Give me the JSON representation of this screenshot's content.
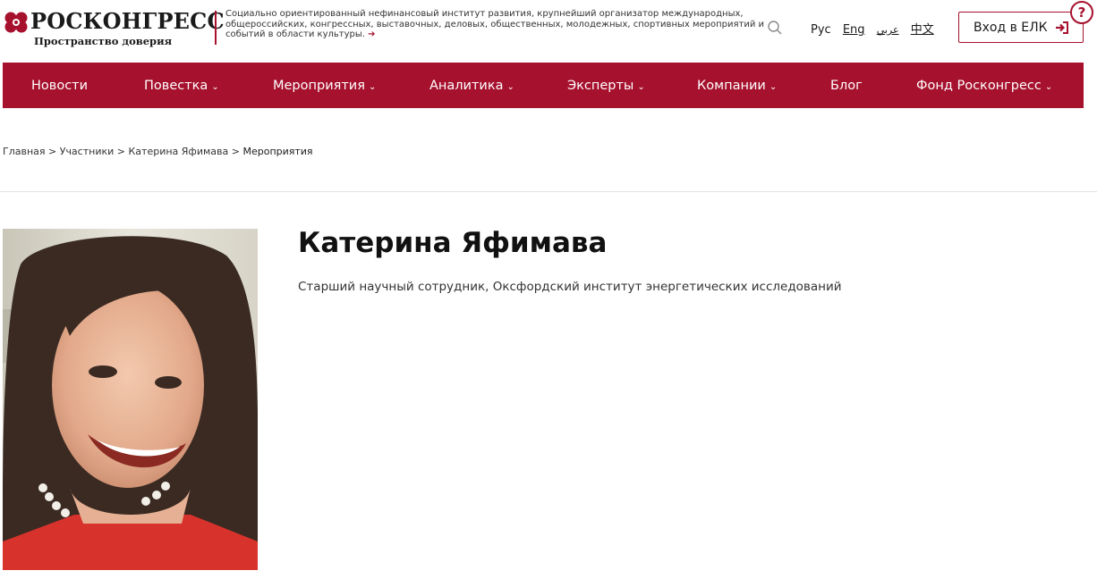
{
  "header": {
    "logo_text": "РОСКОНГРЕСС",
    "logo_subtitle": "Пространство доверия",
    "description": "Социально ориентированный нефинансовый институт развития, крупнейший организатор международных, общероссийских, конгрессных, выставочных, деловых, общественных, молодежных, спортивных мероприятий и событий в области культуры.",
    "description_arrow": "➔",
    "languages": [
      "Рус",
      "Eng",
      "عربي",
      "中文"
    ],
    "login_label": "Вход в ЕЛК",
    "help_label": "?"
  },
  "nav": {
    "items": [
      {
        "label": "Новости",
        "has_dropdown": false
      },
      {
        "label": "Повестка",
        "has_dropdown": true
      },
      {
        "label": "Мероприятия",
        "has_dropdown": true
      },
      {
        "label": "Аналитика",
        "has_dropdown": true
      },
      {
        "label": "Эксперты",
        "has_dropdown": true
      },
      {
        "label": "Компании",
        "has_dropdown": true
      },
      {
        "label": "Блог",
        "has_dropdown": false
      },
      {
        "label": "Фонд Росконгресс",
        "has_dropdown": true
      }
    ],
    "chevron": "⌄"
  },
  "breadcrumb": {
    "items": [
      "Главная",
      "Участники",
      "Катерина Яфимава"
    ],
    "separator": " > ",
    "current": "Мероприятия"
  },
  "profile": {
    "name": "Катерина Яфимава",
    "position": "Старший научный сотрудник, Оксфордский институт энергетических исследований"
  },
  "colors": {
    "brand": "#a6112d",
    "nav_text": "#ffffff",
    "text": "#1a1a1a"
  }
}
